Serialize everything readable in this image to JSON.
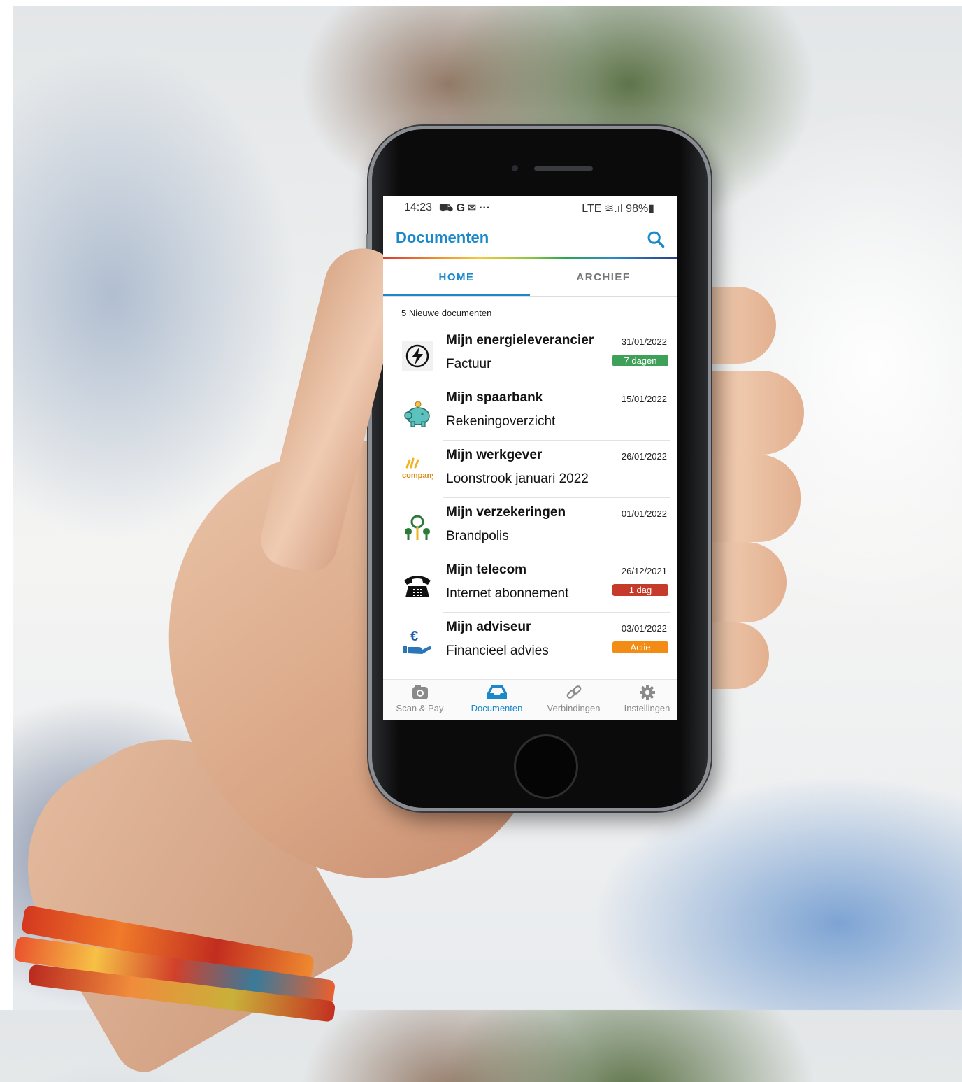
{
  "status_bar": {
    "time": "14:23",
    "left_icons": "⛟ G ✉ ···",
    "right_info": "LTE ≋.ıl 98%▮"
  },
  "app": {
    "title": "Documenten"
  },
  "tabs": [
    {
      "label": "HOME",
      "active": true
    },
    {
      "label": "ARCHIEF",
      "active": false
    }
  ],
  "section_label": "5 Nieuwe documenten",
  "documents": [
    {
      "sender": "Mijn energieleverancier",
      "type": "Factuur",
      "date": "31/01/2022",
      "badge": "7 dagen",
      "badge_color": "#3fa05a",
      "icon": "lightning-icon"
    },
    {
      "sender": "Mijn spaarbank",
      "type": "Rekeningoverzicht",
      "date": "15/01/2022",
      "badge": "",
      "icon": "piggy-bank-icon"
    },
    {
      "sender": "Mijn werkgever",
      "type": "Loonstrook januari 2022",
      "date": "26/01/2022",
      "badge": "",
      "icon": "company-logo-icon",
      "logo_text": "company"
    },
    {
      "sender": "Mijn verzekeringen",
      "type": "Brandpolis",
      "date": "01/01/2022",
      "badge": "",
      "icon": "insurance-tree-icon"
    },
    {
      "sender": "Mijn telecom",
      "type": "Internet abonnement",
      "date": "26/12/2021",
      "badge": "1 dag",
      "badge_color": "#c63a2a",
      "icon": "telephone-icon"
    },
    {
      "sender": "Mijn adviseur",
      "type": "Financieel advies",
      "date": "03/01/2022",
      "badge": "Actie",
      "badge_color": "#f28c14",
      "icon": "euro-hand-icon"
    }
  ],
  "bottom_nav": [
    {
      "label": "Scan & Pay",
      "icon": "camera-icon",
      "active": false
    },
    {
      "label": "Documenten",
      "icon": "inbox-icon",
      "active": true
    },
    {
      "label": "Verbindingen",
      "icon": "link-icon",
      "active": false
    },
    {
      "label": "Instellingen",
      "icon": "gear-icon",
      "active": false
    }
  ],
  "colors": {
    "accent": "#1a88c9"
  }
}
